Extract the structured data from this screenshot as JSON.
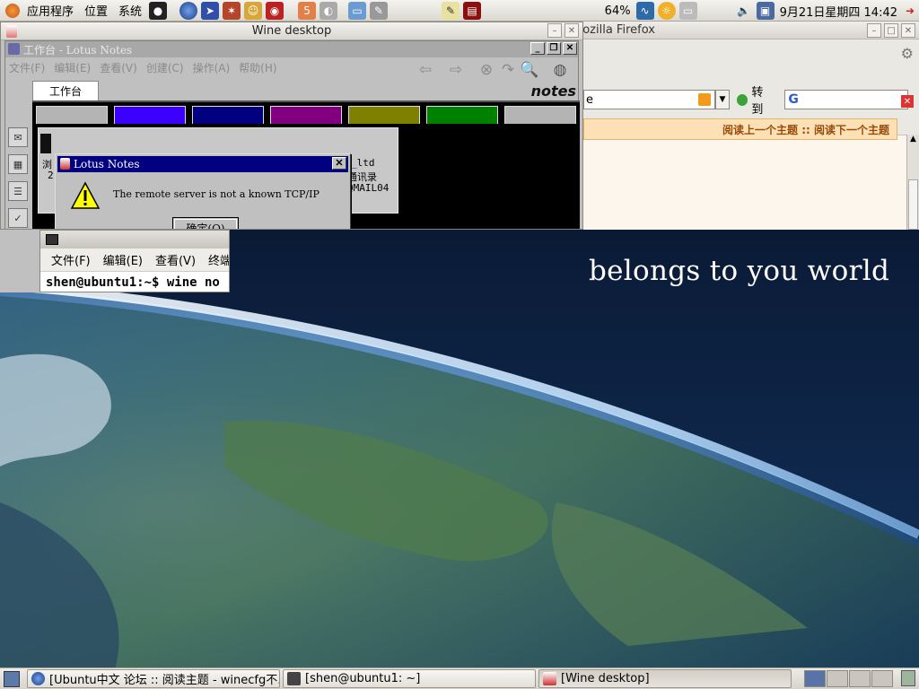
{
  "top_panel": {
    "menus": [
      "应用程序",
      "位置",
      "系统"
    ],
    "battery": "64%",
    "clock": "9月21日星期四 14:42"
  },
  "firefox": {
    "title": "Mozilla Firefox",
    "go_label": "转到",
    "url_fragment": "e",
    "forum_links": "阅读上一个主题 :: 阅读下一个主题"
  },
  "wine": {
    "title": "Wine desktop"
  },
  "notes": {
    "title": "工作台 - Lotus Notes",
    "menus": [
      "文件(F)",
      "编辑(E)",
      "查看(V)",
      "创建(C)",
      "操作(A)",
      "帮助(H)"
    ],
    "tab_label": "工作台",
    "logo": "notes",
    "db_frag_left": "浏",
    "db_frag_2": "2",
    "db_frag_ltd": "_ltd",
    "db_frag_addr": "通讯录",
    "db_frag_mail": "QMAIL04",
    "colors": [
      "#b4b4b4",
      "#3b00ff",
      "#000080",
      "#800080",
      "#808000",
      "#008000",
      "#b4b4b4"
    ]
  },
  "dialog": {
    "title": "Lotus Notes",
    "message": "The remote server is not a known TCP/IP",
    "ok_label": "确定(O)"
  },
  "terminal": {
    "menus": [
      "文件(F)",
      "编辑(E)",
      "查看(V)",
      "终端"
    ],
    "line": "shen@ubuntu1:~$ wine no"
  },
  "wallpaper": {
    "slogan": "belongs to you world"
  },
  "taskbar": {
    "items": [
      {
        "label": "[Ubuntu中文 论坛 :: 阅读主题 - winecfg不..."
      },
      {
        "label": "[shen@ubuntu1: ~]"
      },
      {
        "label": "[Wine desktop]"
      }
    ]
  }
}
